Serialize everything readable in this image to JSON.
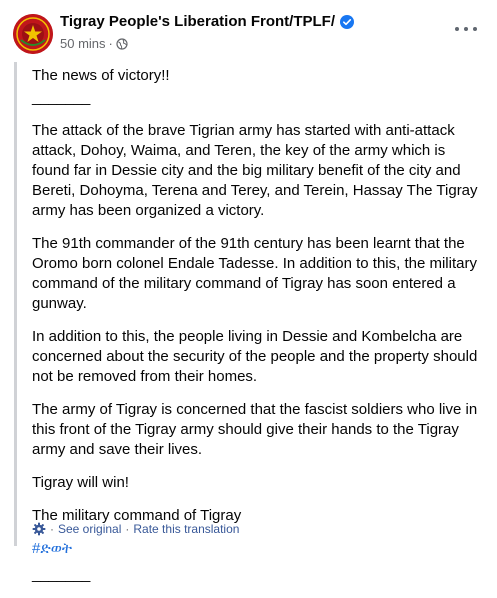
{
  "post": {
    "author": "Tigray People's Liberation Front/TPLF/",
    "time": "50 mins",
    "time_separator": "·",
    "paragraphs": [
      "The news of victory!!",
      "_______",
      "The attack of the brave Tigrian army has started with anti-attack attack, Dohoy, Waima, and Teren, the key of the army which is found far in Dessie city and the big military benefit of the city and Bereti, Dohoyma, Terena and Terey, and Terein, Hassay The Tigray army has been organized a victory.",
      "The 91th commander of the 91th century has been learnt that the Oromo born colonel Endale Tadesse. In addition to this, the military command of the military command of Tigray has soon entered a gunway.",
      "In addition to this, the people living in Dessie and Kombelcha are concerned about the security of the people and the property should not be removed from their homes.",
      "The army of Tigray is concerned that the fascist soldiers who live in this front of the Tigray army should give their hands to the Tigray army and save their lives.",
      "Tigray will win!",
      "The military command of Tigray"
    ],
    "hashtag": "#ድወት",
    "footer_rule": "_______",
    "see_original": "See original",
    "translation_separator": "·",
    "rate_translation": "Rate this translation"
  },
  "colors": {
    "link": "#216fdb",
    "meta": "#65676b",
    "verified": "#1877f2",
    "avatar": "#c0161b"
  },
  "icons": {
    "verified": "verified-badge-icon",
    "audience": "globe-icon",
    "more": "more-options-icon",
    "translate": "gear-icon"
  }
}
